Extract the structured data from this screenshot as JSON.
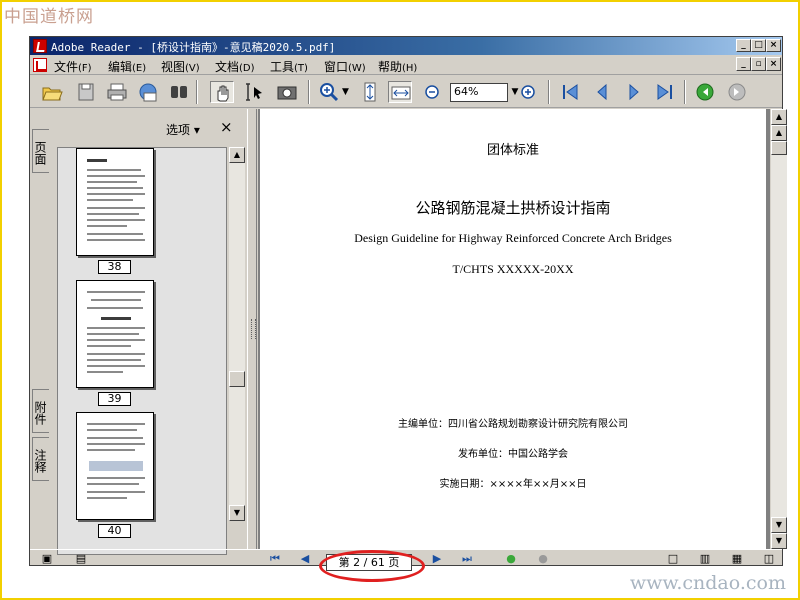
{
  "watermark": {
    "top": "中国道桥网",
    "bottom": "www.cndao.com"
  },
  "window": {
    "title": "Adobe Reader - [桥设计指南》-意见稿2020.5.pdf]",
    "controls": [
      "_",
      "□",
      "×"
    ]
  },
  "menubar": {
    "items": [
      {
        "label": "文件",
        "key": "(F)"
      },
      {
        "label": "编辑",
        "key": "(E)"
      },
      {
        "label": "视图",
        "key": "(V)"
      },
      {
        "label": "文档",
        "key": "(D)"
      },
      {
        "label": "工具",
        "key": "(T)"
      },
      {
        "label": "窗口",
        "key": "(W)"
      },
      {
        "label": "帮助",
        "key": "(H)"
      }
    ],
    "mdi_controls": [
      "_",
      "▫",
      "×"
    ]
  },
  "toolbar": {
    "zoom_value": "64%"
  },
  "nav_pane": {
    "tabs": [
      "页面",
      "附件",
      "注释"
    ],
    "options_label": "选项 ▾",
    "close_label": "×",
    "thumbnails": [
      {
        "page": "38"
      },
      {
        "page": "39"
      },
      {
        "page": "40"
      }
    ]
  },
  "document": {
    "org_label": "团体标准",
    "title_cn": "公路钢筋混凝土拱桥设计指南",
    "title_en": "Design Guideline for Highway Reinforced Concrete Arch Bridges",
    "code": "T/CHTS XXXXX-20XX",
    "editor": "主编单位：四川省公路规划勘察设计研究院有限公司",
    "publisher": "发布单位：中国公路学会",
    "date": "实施日期：××××年××月××日"
  },
  "statusbar": {
    "page_indicator": "第 2 / 61 页"
  },
  "colors": {
    "title_bar": "#0a246a",
    "frame": "#f2d000",
    "annotation": "#e02020"
  }
}
